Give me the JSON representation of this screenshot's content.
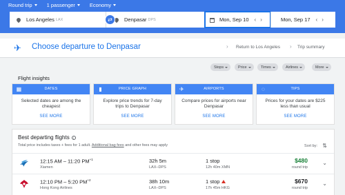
{
  "search_options": {
    "trip_type": "Round trip",
    "passengers": "1 passenger",
    "cabin": "Economy"
  },
  "search": {
    "origin": "Los Angeles",
    "origin_code": "LAX",
    "destination": "Denpasar",
    "destination_code": "DPS",
    "depart_date": "Mon, Sep 10",
    "return_date": "Mon, Sep 17"
  },
  "header": {
    "title": "Choose departure to Denpasar",
    "breadcrumb_return": "Return to Los Angeles",
    "breadcrumb_summary": "Trip summary"
  },
  "filters": [
    "Stops",
    "Price",
    "Times",
    "Airlines",
    "More"
  ],
  "insights": {
    "title": "Flight insights",
    "cards": [
      {
        "label": "DATES",
        "icon": "calendar-icon",
        "text": "Selected dates are among the cheapest",
        "more": "SEE MORE"
      },
      {
        "label": "PRICE GRAPH",
        "icon": "bar-chart-icon",
        "text": "Explore price trends for 7-day trips to Denpasar",
        "more": "SEE MORE"
      },
      {
        "label": "AIRPORTS",
        "icon": "airplane-icon",
        "text": "Compare prices for airports near Denpasar",
        "more": "SEE MORE"
      },
      {
        "label": "TIPS",
        "icon": "lightbulb-icon",
        "text": "Prices for your dates are $225 less than usual",
        "more": "SEE MORE"
      }
    ]
  },
  "results": {
    "title": "Best departing flights",
    "note_prefix": "Total price includes taxes + fees for 1 adult.",
    "note_link": "Additional bag fees",
    "note_suffix": "and other fees may apply",
    "sort_label": "Sort by:",
    "flights": [
      {
        "times": "12:15 AM – 11:20 PM",
        "day_offset": "+1",
        "airline": "Xiamen",
        "duration": "32h 5m",
        "route": "LAX–DPS",
        "stops": "1 stop",
        "layover": "12h 40m XMN",
        "warning": false,
        "price": "$480",
        "price_color": "#188038",
        "price_type": "round trip"
      },
      {
        "times": "12:10 PM – 5:20 PM",
        "day_offset": "+2",
        "airline": "Hong Kong Airlines",
        "duration": "38h 10m",
        "route": "LAX–DPS",
        "stops": "1 stop",
        "layover": "17h 45m HKG",
        "warning": true,
        "price": "$670",
        "price_color": "#202124",
        "price_type": "round trip"
      }
    ]
  },
  "colors": {
    "brand_blue": "#3b78e7",
    "card_blue": "#4285f4",
    "link_blue": "#1a73e8",
    "cheap_green": "#188038",
    "warning_red": "#d93025"
  }
}
